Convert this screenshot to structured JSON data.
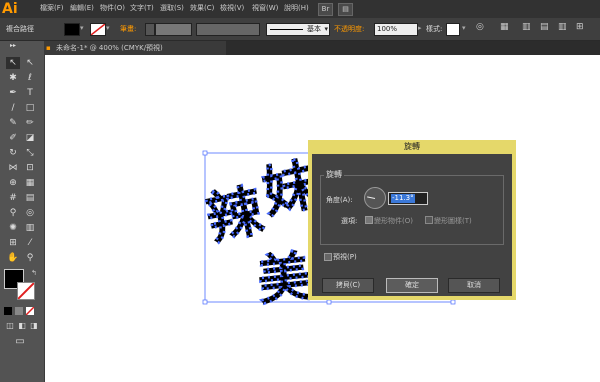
{
  "app": {
    "logo": "Ai"
  },
  "menu": [
    "檔案(F)",
    "編輯(E)",
    "物件(O)",
    "文字(T)",
    "選取(S)",
    "效果(C)",
    "檢視(V)",
    "視窗(W)",
    "說明(H)"
  ],
  "menubar_icons": [
    "Br",
    "▤"
  ],
  "control": {
    "selection_label": "複合路徑",
    "stroke_label": "筆畫:",
    "stroke_style": "基本",
    "opacity_label": "不透明度:",
    "opacity_value": "100%",
    "style_label": "樣式:"
  },
  "document": {
    "tab_title": "未命名-1* @ 400% (CMYK/預視)"
  },
  "artwork": {
    "chars": [
      "辣",
      "妹",
      "美"
    ]
  },
  "dialog": {
    "title": "旋轉",
    "group_label": "旋轉",
    "angle_label": "角度(A):",
    "angle_value": "-11.3°",
    "options_label": "選項:",
    "transform_objects": "變形物件(O)",
    "transform_patterns": "變形圖樣(T)",
    "preview": "預視(P)",
    "copy_button": "拷貝(C)",
    "ok_button": "確定",
    "cancel_button": "取消"
  },
  "colors": {
    "dialog_highlight": "#e5d86a",
    "selection": "#4a6cff",
    "accent": "#ff9a00"
  }
}
